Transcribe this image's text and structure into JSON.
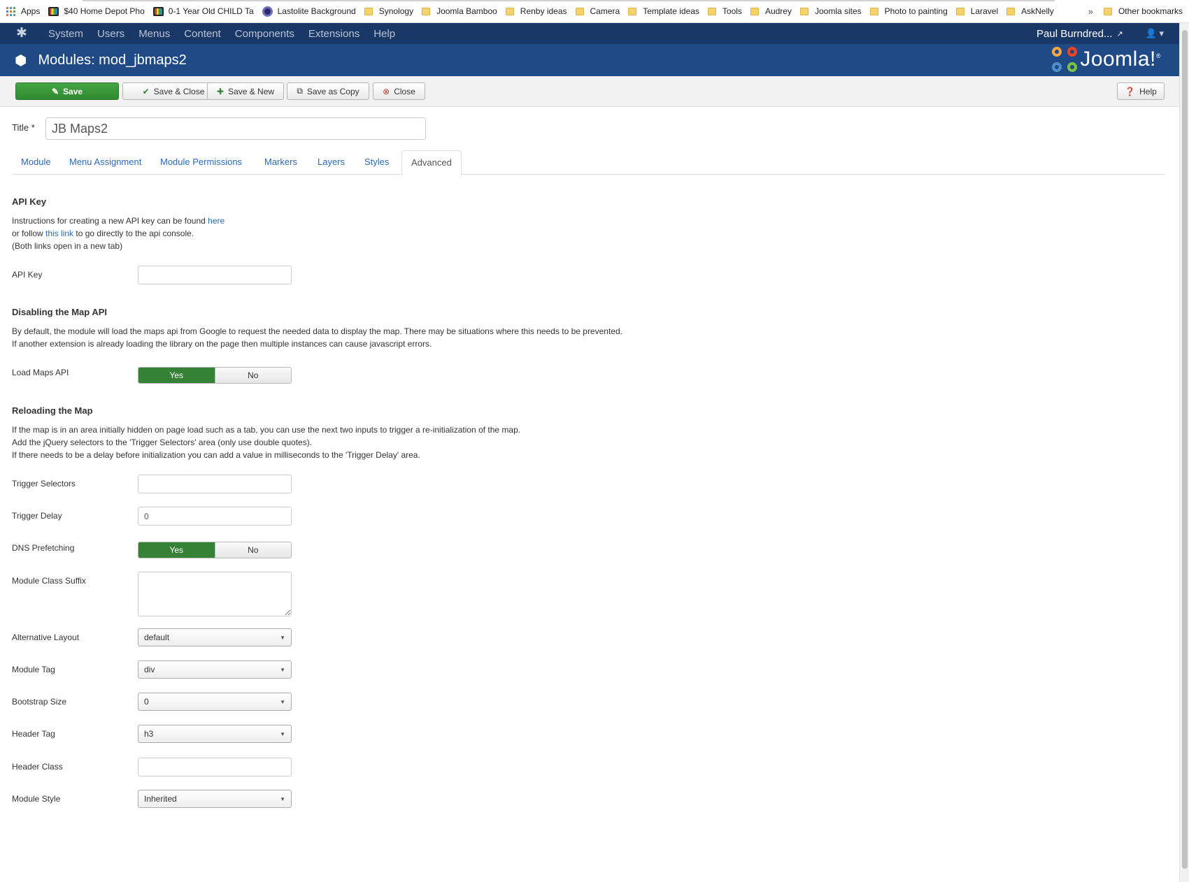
{
  "bookmarks": {
    "apps": "Apps",
    "items": [
      {
        "label": "$40 Home Depot Pho",
        "icon": "stripe"
      },
      {
        "label": "0-1 Year Old CHILD Ta",
        "icon": "stripe"
      },
      {
        "label": "Lastolite Background",
        "icon": "circle"
      },
      {
        "label": "Synology",
        "icon": "folder"
      },
      {
        "label": "Joomla Bamboo",
        "icon": "folder"
      },
      {
        "label": "Renby ideas",
        "icon": "folder"
      },
      {
        "label": "Camera",
        "icon": "folder"
      },
      {
        "label": "Template ideas",
        "icon": "folder"
      },
      {
        "label": "Tools",
        "icon": "folder"
      },
      {
        "label": "Audrey",
        "icon": "folder"
      },
      {
        "label": "Joomla sites",
        "icon": "folder"
      },
      {
        "label": "Photo to painting",
        "icon": "folder"
      },
      {
        "label": "Laravel",
        "icon": "folder"
      },
      {
        "label": "AskNelly",
        "icon": "folder"
      }
    ],
    "more": "»",
    "other": "Other bookmarks"
  },
  "nav": {
    "items": [
      "System",
      "Users",
      "Menus",
      "Content",
      "Components",
      "Extensions",
      "Help"
    ],
    "user": "Paul Burndred...",
    "user_caret": "▾"
  },
  "header": {
    "title": "Modules: mod_jbmaps2",
    "brand": "Joomla!"
  },
  "toolbar": {
    "save": "Save",
    "save_close": "Save & Close",
    "save_new": "Save & New",
    "save_copy": "Save as Copy",
    "close": "Close",
    "help": "Help"
  },
  "form": {
    "title_label": "Title *",
    "title_value": "JB Maps2",
    "tabs": [
      "Module",
      "Menu Assignment",
      "Module Permissions",
      "Markers",
      "Layers",
      "Styles",
      "Advanced"
    ],
    "active_tab": "Advanced",
    "api_section": {
      "heading": "API Key",
      "line1_prefix": "Instructions for creating a new API key can be found ",
      "line1_link": "here",
      "line2_prefix": "or follow ",
      "line2_link": "this link",
      "line2_suffix": " to go directly to the api console.",
      "line3": "(Both links open in a new tab)",
      "api_key_label": "API Key",
      "api_key_value": ""
    },
    "disable_section": {
      "heading": "Disabling the Map API",
      "line1": "By default, the module will load the maps api from Google to request the needed data to display the map. There may be situations where this needs to be prevented.",
      "line2": "If another extension is already loading the library on the page then multiple instances can cause javascript errors.",
      "load_label": "Load Maps API",
      "yes": "Yes",
      "no": "No",
      "load_value": "Yes"
    },
    "reload_section": {
      "heading": "Reloading the Map",
      "line1": "If the map is in an area initially hidden on page load such as a tab, you can use the next two inputs to trigger a re-initialization of the map.",
      "line2": "Add the jQuery selectors to the 'Trigger Selectors' area (only use double quotes).",
      "line3": "If there needs to be a delay before initialization you can add a value in milliseconds to the 'Trigger Delay' area.",
      "trigger_selectors_label": "Trigger Selectors",
      "trigger_selectors_value": "",
      "trigger_delay_label": "Trigger Delay",
      "trigger_delay_value": "0",
      "dns_label": "DNS Prefetching",
      "dns_value": "Yes",
      "class_suffix_label": "Module Class Suffix",
      "class_suffix_value": "",
      "alt_layout_label": "Alternative Layout",
      "alt_layout_value": "default",
      "module_tag_label": "Module Tag",
      "module_tag_value": "div",
      "bootstrap_label": "Bootstrap Size",
      "bootstrap_value": "0",
      "header_tag_label": "Header Tag",
      "header_tag_value": "h3",
      "header_class_label": "Header Class",
      "header_class_value": "",
      "module_style_label": "Module Style",
      "module_style_value": "Inherited"
    }
  },
  "colors": {
    "nav_bg": "#1a3867",
    "title_bg": "#1f4a86",
    "save_green": "#378137",
    "link_blue": "#2a69b8"
  }
}
